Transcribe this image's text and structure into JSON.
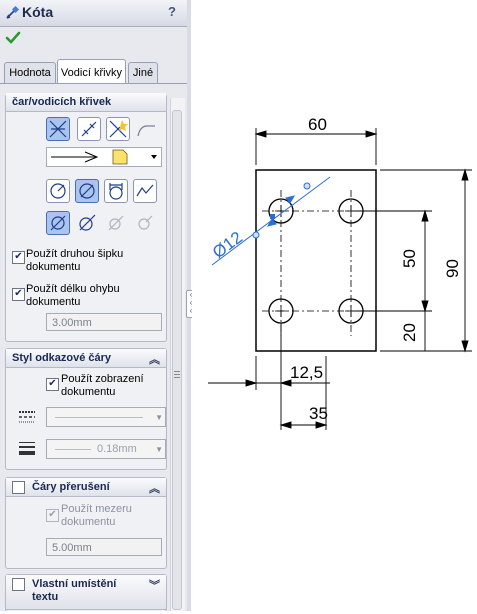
{
  "panel": {
    "title": "Kóta",
    "help": "?",
    "tabs": [
      "Hodnota",
      "Vodicí křivky",
      "Jiné"
    ],
    "active_tab": "Vodicí křivky",
    "section_leaders": {
      "title": "čar/vodicích křivek",
      "use_second_arrow": "Použít druhou šipku dokumentu",
      "use_bend_length": "Použít délku ohybu dokumentu",
      "bend_length_value": "3.00mm"
    },
    "section_leader_style": {
      "title": "Styl odkazové čáry",
      "use_doc_display": "Použít zobrazení dokumentu",
      "line_thickness_value": "0.18mm"
    },
    "section_break_lines": {
      "title": "Čáry přerušení",
      "use_gap": "Použít mezeru dokumentu",
      "gap_value": "5.00mm"
    },
    "section_text_position": {
      "title": "Vlastní umístění textu"
    }
  },
  "drawing": {
    "dim_top": "60",
    "dim_50": "50",
    "dim_90": "90",
    "dim_20": "20",
    "dim_12_5": "12,5",
    "dim_35": "35",
    "dim_diameter": "Ø12"
  },
  "colors": {
    "selected_dim": "#2a6fd6",
    "panel_bg": "#e8e9ee"
  }
}
